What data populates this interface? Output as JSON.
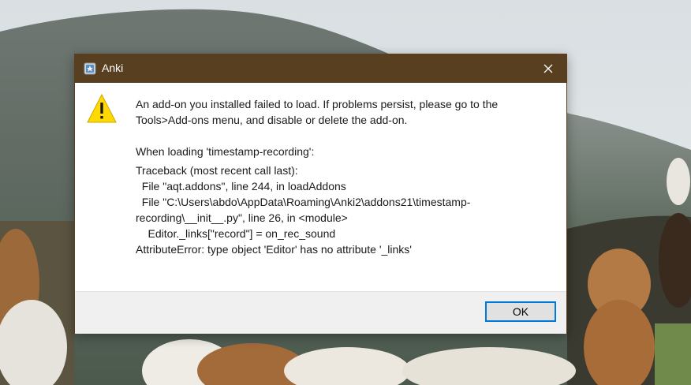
{
  "dialog": {
    "title": "Anki",
    "icon": "anki-star-icon",
    "close_icon": "close-icon",
    "warning_icon": "warning-icon",
    "message_lines": [
      "An add-on you installed failed to load. If problems persist, please go to the",
      "Tools>Add-ons menu, and disable or delete the add-on."
    ],
    "loading_line": "When loading 'timestamp-recording':",
    "traceback": [
      "Traceback (most recent call last):",
      "  File \"aqt.addons\", line 244, in loadAddons",
      "  File \"C:\\Users\\abdo\\AppData\\Roaming\\Anki2\\addons21\\timestamp-",
      "recording\\__init__.py\", line 26, in <module>",
      "    Editor._links[\"record\"] = on_rec_sound",
      "AttributeError: type object 'Editor' has no attribute '_links'"
    ],
    "ok_label": "OK"
  },
  "colors": {
    "titlebar": "#573f20",
    "ok_border": "#0078d7",
    "footer": "#f0f0f0"
  }
}
